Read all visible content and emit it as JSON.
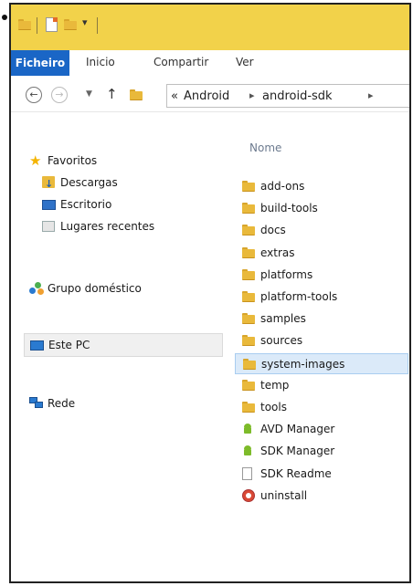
{
  "window": {
    "ribbon_tabs": [
      "Ficheiro",
      "Inicio",
      "Compartir",
      "Ver"
    ],
    "address": {
      "overflow": "«",
      "crumbs": [
        "Android",
        "android-sdk"
      ]
    }
  },
  "sidebar": {
    "favorites_label": "Favoritos",
    "favorites": [
      "Descargas",
      "Escritorio",
      "Lugares recentes"
    ],
    "homegroup_label": "Grupo doméstico",
    "pc_label": "Este PC",
    "network_label": "Rede"
  },
  "content": {
    "column_header": "Nome",
    "items": [
      {
        "name": "add-ons",
        "type": "folder"
      },
      {
        "name": "build-tools",
        "type": "folder"
      },
      {
        "name": "docs",
        "type": "folder"
      },
      {
        "name": "extras",
        "type": "folder"
      },
      {
        "name": "platforms",
        "type": "folder"
      },
      {
        "name": "platform-tools",
        "type": "folder"
      },
      {
        "name": "samples",
        "type": "folder"
      },
      {
        "name": "sources",
        "type": "folder"
      },
      {
        "name": "system-images",
        "type": "folder",
        "highlighted": true
      },
      {
        "name": "temp",
        "type": "folder"
      },
      {
        "name": "tools",
        "type": "folder"
      },
      {
        "name": "AVD Manager",
        "type": "android-app"
      },
      {
        "name": "SDK Manager",
        "type": "android-app"
      },
      {
        "name": "SDK Readme",
        "type": "text-document"
      },
      {
        "name": "uninstall",
        "type": "uninstaller"
      }
    ]
  },
  "colors": {
    "title_bar": "#f2d24a",
    "active_tab": "#1a66c6",
    "highlight": "#dbeaf9"
  }
}
